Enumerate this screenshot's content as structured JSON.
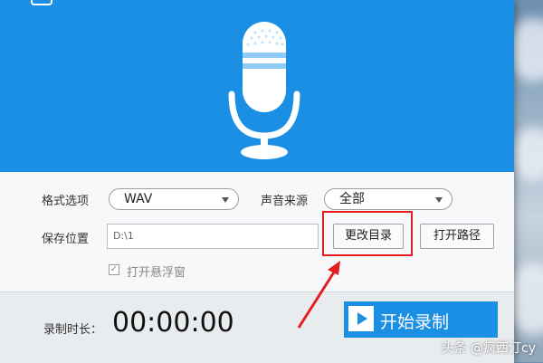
{
  "colors": {
    "accent": "#1a8fe3",
    "highlight": "#e41e1e",
    "mic_body": "#ffffff",
    "mic_stripe": "#8ecaf4"
  },
  "form": {
    "format_label": "格式选项",
    "format_value": "WAV",
    "source_label": "声音来源",
    "source_value": "全部",
    "save_label": "保存位置",
    "save_path": "D:\\1",
    "change_dir_button": "更改目录",
    "open_path_button": "打开路径",
    "float_window_label": "打开悬浮窗",
    "float_window_checked": true
  },
  "bottom": {
    "duration_label": "录制时长：",
    "duration_value": "00:00:00",
    "start_button": "开始录制"
  },
  "icons": {
    "microphone": "microphone-icon",
    "play": "play-icon",
    "checkbox": "checkmark-icon"
  },
  "watermark": "头条 @疯西汀cy"
}
